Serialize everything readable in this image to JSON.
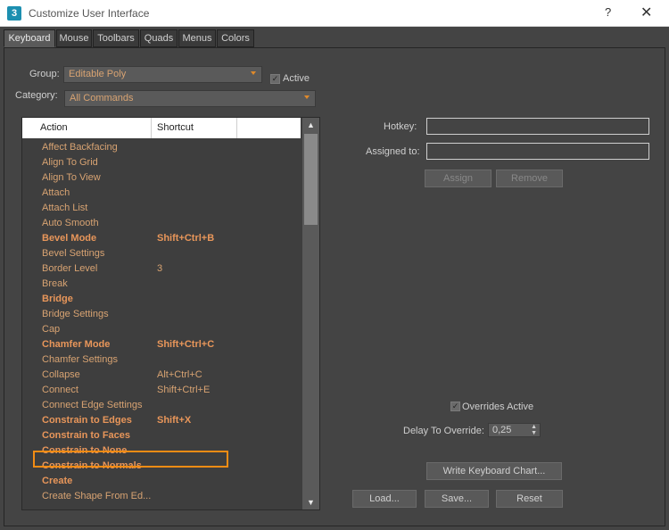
{
  "window": {
    "title": "Customize User Interface",
    "app_icon": "3",
    "help": "?",
    "close": "✕"
  },
  "tabs": [
    {
      "label": "Keyboard",
      "active": true
    },
    {
      "label": "Mouse"
    },
    {
      "label": "Toolbars"
    },
    {
      "label": "Quads"
    },
    {
      "label": "Menus"
    },
    {
      "label": "Colors"
    }
  ],
  "group": {
    "label": "Group:",
    "value": "Editable Poly",
    "active_label": "Active",
    "active_checked": true
  },
  "category": {
    "label": "Category:",
    "value": "All Commands"
  },
  "list": {
    "headers": {
      "action": "Action",
      "shortcut": "Shortcut"
    },
    "rows": [
      {
        "action": "Affect Backfacing",
        "shortcut": ""
      },
      {
        "action": "Align To Grid",
        "shortcut": ""
      },
      {
        "action": "Align To View",
        "shortcut": ""
      },
      {
        "action": "Attach",
        "shortcut": ""
      },
      {
        "action": "Attach List",
        "shortcut": ""
      },
      {
        "action": "Auto Smooth",
        "shortcut": ""
      },
      {
        "action": "Bevel Mode",
        "shortcut": "Shift+Ctrl+B",
        "bold": true
      },
      {
        "action": "Bevel Settings",
        "shortcut": ""
      },
      {
        "action": "Border Level",
        "shortcut": "3"
      },
      {
        "action": "Break",
        "shortcut": ""
      },
      {
        "action": "Bridge",
        "shortcut": "",
        "bold": true
      },
      {
        "action": "Bridge Settings",
        "shortcut": ""
      },
      {
        "action": "Cap",
        "shortcut": ""
      },
      {
        "action": "Chamfer Mode",
        "shortcut": "Shift+Ctrl+C",
        "bold": true
      },
      {
        "action": "Chamfer Settings",
        "shortcut": ""
      },
      {
        "action": "Collapse",
        "shortcut": "Alt+Ctrl+C"
      },
      {
        "action": "Connect",
        "shortcut": "Shift+Ctrl+E",
        "highlighted": true
      },
      {
        "action": "Connect Edge Settings",
        "shortcut": ""
      },
      {
        "action": "Constrain to Edges",
        "shortcut": "Shift+X",
        "bold": true
      },
      {
        "action": "Constrain to Faces",
        "shortcut": "",
        "bold": true
      },
      {
        "action": "Constrain to None",
        "shortcut": "",
        "bold": true
      },
      {
        "action": "Constrain to Normals",
        "shortcut": "",
        "bold": true
      },
      {
        "action": "Create",
        "shortcut": "",
        "bold": true
      },
      {
        "action": "Create Shape From Ed...",
        "shortcut": ""
      }
    ]
  },
  "hotkey": {
    "label": "Hotkey:",
    "value": ""
  },
  "assigned_to": {
    "label": "Assigned to:",
    "value": ""
  },
  "buttons": {
    "assign": "Assign",
    "remove": "Remove",
    "write_chart": "Write Keyboard Chart...",
    "load": "Load...",
    "save": "Save...",
    "reset": "Reset"
  },
  "overrides": {
    "label": "Overrides Active",
    "checked": true
  },
  "delay": {
    "label": "Delay To Override:",
    "value": "0,25"
  },
  "colors": {
    "accent_text": "#d8a372",
    "highlight_border": "#f28c14",
    "panel_bg": "#444444"
  }
}
